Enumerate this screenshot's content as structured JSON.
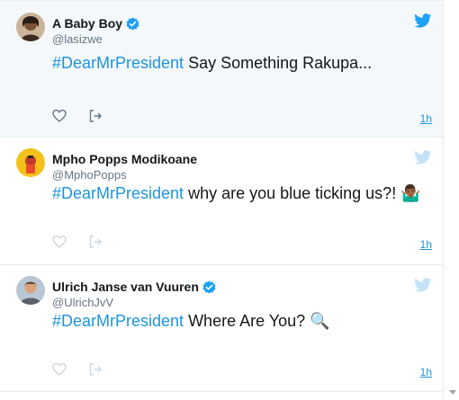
{
  "tweets": [
    {
      "name": "A Baby Boy",
      "handle": "@lasizwe",
      "verified": true,
      "hashtag": "#DearMrPresident",
      "text": " Say Something Rakupa...",
      "emoji": "",
      "time": "1h",
      "icons": {
        "avatar": "avatar-photo",
        "bird": "twitter-bird-icon",
        "like": "heart-icon",
        "share": "share-icon"
      }
    },
    {
      "name": "Mpho Popps Modikoane",
      "handle": "@MphoPopps",
      "verified": false,
      "hashtag": "#DearMrPresident",
      "text": " why are you blue ticking us?! ",
      "emoji": "🤷🏾‍♂️",
      "time": "1h",
      "icons": {
        "avatar": "avatar-photo",
        "bird": "twitter-bird-icon",
        "like": "heart-icon",
        "share": "share-icon"
      }
    },
    {
      "name": "Ulrich Janse van Vuuren",
      "handle": "@UlrichJvV",
      "verified": true,
      "hashtag": "#DearMrPresident",
      "text": " Where Are You? ",
      "emoji": "🔍",
      "time": "1h",
      "icons": {
        "avatar": "avatar-photo",
        "bird": "twitter-bird-icon",
        "like": "heart-icon",
        "share": "share-icon"
      }
    }
  ],
  "colors": {
    "accent": "#1b95e0",
    "bird_active": "#1da1f2",
    "bird_muted": "#c4e3f7",
    "muted_text": "#657786",
    "hover_bg": "#f5f8fa"
  }
}
